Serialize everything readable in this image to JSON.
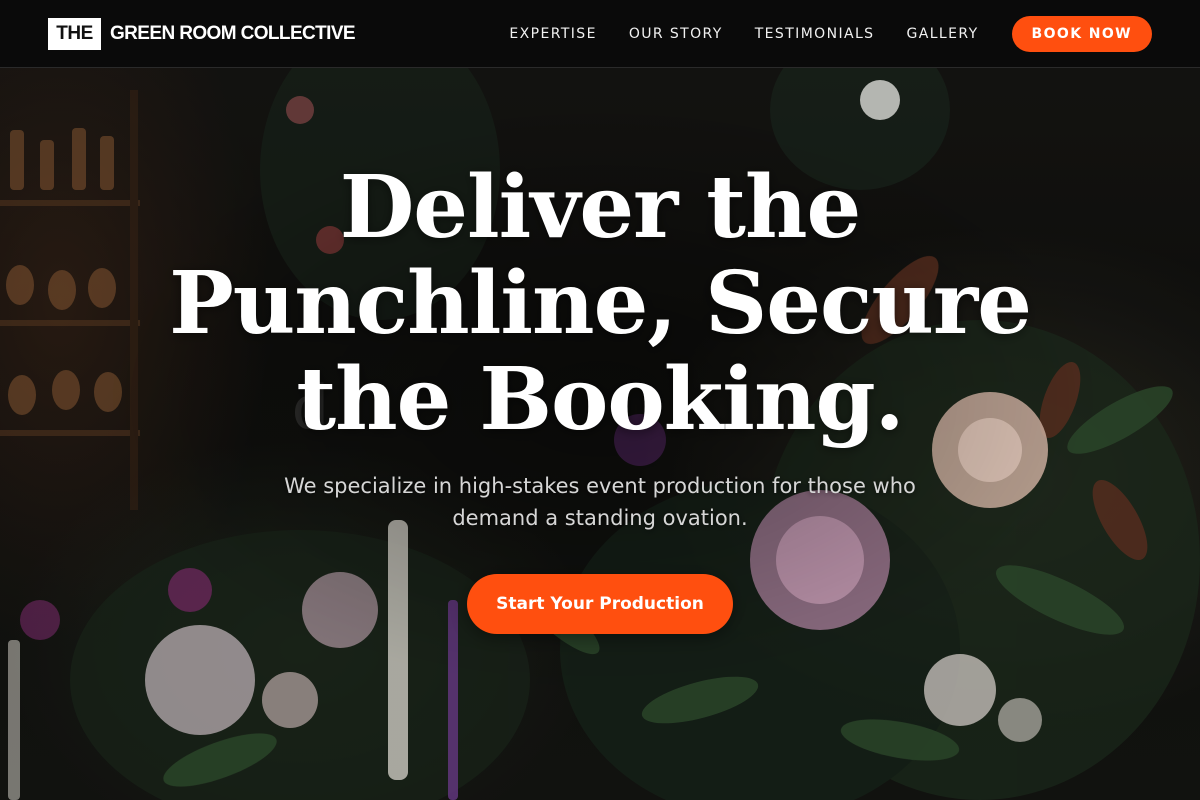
{
  "brand": {
    "logo_box_text": "THE",
    "logo_text": "GREEN ROOM COLLECTIVE"
  },
  "nav": {
    "items": [
      {
        "label": "EXPERTISE"
      },
      {
        "label": "OUR STORY"
      },
      {
        "label": "TESTIMONIALS"
      },
      {
        "label": "GALLERY"
      }
    ],
    "cta_label": "BOOK NOW"
  },
  "hero": {
    "headline": "Deliver the Punchline, Secure the Booking.",
    "subtext": "We specialize in high-stakes event production for those who demand a standing ovation.",
    "cta_label": "Start Your Production"
  },
  "colors": {
    "accent": "#ff4f0f",
    "header_bg": "#0a0a0a",
    "text_primary": "#ffffff",
    "text_secondary": "#d6d6d6"
  }
}
